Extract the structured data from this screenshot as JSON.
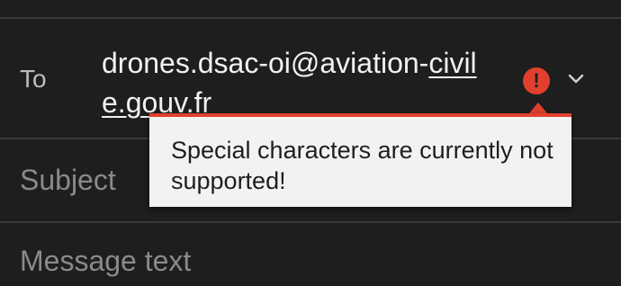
{
  "to_field": {
    "label": "To",
    "recipient_line1_plain": "drones.dsac-oi@aviation-",
    "recipient_line1_underlined": "civil",
    "recipient_line2_underlined": "e.gouv.fr",
    "error_icon_glyph": "!",
    "error_color": "#e2402f",
    "expand_icon": "chevron-down-icon"
  },
  "tooltip": {
    "text": "Special characters are currently not supported!"
  },
  "subject_field": {
    "placeholder": "Subject"
  },
  "message_field": {
    "placeholder": "Message text"
  }
}
